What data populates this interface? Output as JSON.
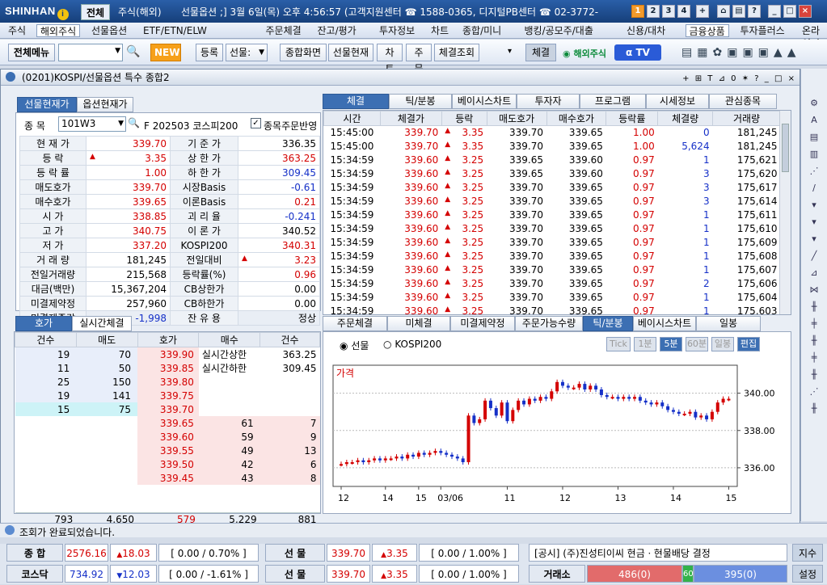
{
  "app": {
    "logo": "SHINHAN",
    "logo_mark": "i",
    "tabs": [
      "전체",
      "주식(해외)"
    ],
    "info": "선물옵션 ;] 3월 6일(목) 오후 4:56:57 (고객지원센터 ☎ 1588-0365, 디지털PB센터 ☎ 02-3772-",
    "win_nums": [
      "1",
      "2",
      "3",
      "4"
    ]
  },
  "menu": [
    "주식",
    "해외주식",
    "선물옵션",
    "ETF/ETN/ELW",
    "주문체결",
    "잔고/평가",
    "투자정보",
    "차트",
    "종합/미니",
    "뱅킹/공모주/대출",
    "신용/대차",
    "금융상품",
    "투자플러스",
    "온라인지점"
  ],
  "toolbar": {
    "all_menu": "전체메뉴",
    "new": "NEW",
    "b1": "등록",
    "sel": "선물:",
    "b2": "종합화면",
    "b3": "선물현재",
    "b4": "차트",
    "b5": "주문",
    "b6": "체결조회",
    "chegyeol": "체결",
    "overseas": "해외주식",
    "tv": "TV"
  },
  "window": {
    "title": "(0201)KOSPI/선물옵션 특수 종합2"
  },
  "left": {
    "tabs": [
      "선물현재가",
      "옵션현재가"
    ],
    "code_label": "종 목",
    "code": "101W3",
    "name": "F 202503 코스피200",
    "check_label": "종목주문반영",
    "rows": [
      {
        "l1": "현 재 가",
        "v1": "339.70",
        "c1": "red",
        "l2": "기 준 가",
        "v2": "336.35",
        "c2": ""
      },
      {
        "l1": "등 락",
        "v1": "3.35",
        "c1": "red",
        "ar": "up",
        "l2": "상 한 가",
        "v2": "363.25",
        "c2": "red"
      },
      {
        "l1": "등 락 률",
        "v1": "1.00",
        "c1": "red",
        "l2": "하 한 가",
        "v2": "309.45",
        "c2": "blue"
      },
      {
        "l1": "매도호가",
        "v1": "339.70",
        "c1": "red",
        "l2": "시장Basis",
        "v2": "-0.61",
        "c2": "blue"
      },
      {
        "l1": "매수호가",
        "v1": "339.65",
        "c1": "red",
        "l2": "이론Basis",
        "v2": "0.21",
        "c2": "red"
      },
      {
        "l1": "시 가",
        "v1": "338.85",
        "c1": "red",
        "l2": "괴 리 율",
        "v2": "-0.241",
        "c2": "blue"
      },
      {
        "l1": "고 가",
        "v1": "340.75",
        "c1": "red",
        "l2": "이 론 가",
        "v2": "340.52",
        "c2": ""
      },
      {
        "l1": "저 가",
        "v1": "337.20",
        "c1": "red",
        "l2": "KOSPI200",
        "v2": "340.31",
        "c2": "red"
      },
      {
        "l1": "거 래 량",
        "v1": "181,245",
        "c1": "",
        "l2": "전일대비",
        "v2": "3.23",
        "c2": "red",
        "ar2": "up"
      },
      {
        "l1": "전일거래량",
        "v1": "215,568",
        "c1": "",
        "l2": "등락률(%)",
        "v2": "0.96",
        "c2": "red"
      },
      {
        "l1": "대금(백만)",
        "v1": "15,367,204",
        "c1": "",
        "l2": "CB상한가",
        "v2": "0.00",
        "c2": ""
      },
      {
        "l1": "미결제약정",
        "v1": "257,960",
        "c1": "",
        "l2": "CB하한가",
        "v2": "0.00",
        "c2": ""
      },
      {
        "l1": "미결제증감",
        "v1": "-1,998",
        "c1": "blue",
        "l2": "잔 유 용",
        "v2": "정상",
        "c2": ""
      }
    ]
  },
  "right": {
    "tabs": [
      "체결",
      "틱/분봉",
      "베이시스차트",
      "투자자",
      "프로그램",
      "시세정보",
      "관심종목"
    ],
    "headers": [
      "시간",
      "체결가",
      "등락",
      "매도호가",
      "매수호가",
      "등락률",
      "체결량",
      "거래량"
    ],
    "rows": [
      [
        "15:45:00",
        "339.70",
        "3.35",
        "339.70",
        "339.65",
        "1.00",
        "0",
        "181,245"
      ],
      [
        "15:45:00",
        "339.70",
        "3.35",
        "339.70",
        "339.65",
        "1.00",
        "5,624",
        "181,245"
      ],
      [
        "15:34:59",
        "339.60",
        "3.25",
        "339.65",
        "339.60",
        "0.97",
        "1",
        "175,621"
      ],
      [
        "15:34:59",
        "339.60",
        "3.25",
        "339.65",
        "339.60",
        "0.97",
        "3",
        "175,620"
      ],
      [
        "15:34:59",
        "339.60",
        "3.25",
        "339.70",
        "339.65",
        "0.97",
        "3",
        "175,617"
      ],
      [
        "15:34:59",
        "339.60",
        "3.25",
        "339.70",
        "339.65",
        "0.97",
        "3",
        "175,614"
      ],
      [
        "15:34:59",
        "339.60",
        "3.25",
        "339.70",
        "339.65",
        "0.97",
        "1",
        "175,611"
      ],
      [
        "15:34:59",
        "339.60",
        "3.25",
        "339.70",
        "339.65",
        "0.97",
        "1",
        "175,610"
      ],
      [
        "15:34:59",
        "339.60",
        "3.25",
        "339.70",
        "339.65",
        "0.97",
        "1",
        "175,609"
      ],
      [
        "15:34:59",
        "339.60",
        "3.25",
        "339.70",
        "339.65",
        "0.97",
        "1",
        "175,608"
      ],
      [
        "15:34:59",
        "339.60",
        "3.25",
        "339.70",
        "339.65",
        "0.97",
        "1",
        "175,607"
      ],
      [
        "15:34:59",
        "339.60",
        "3.25",
        "339.70",
        "339.65",
        "0.97",
        "2",
        "175,606"
      ],
      [
        "15:34:59",
        "339.60",
        "3.25",
        "339.70",
        "339.65",
        "0.97",
        "1",
        "175,604"
      ],
      [
        "15:34:59",
        "339.60",
        "3.25",
        "339.70",
        "339.65",
        "0.97",
        "1",
        "175,603"
      ]
    ]
  },
  "order": {
    "tabs": [
      "호가",
      "실시간체결"
    ],
    "headers": [
      "건수",
      "매도",
      "호가",
      "매수",
      "건수"
    ],
    "asks": [
      [
        "19",
        "70",
        "339.90"
      ],
      [
        "11",
        "50",
        "339.85"
      ],
      [
        "25",
        "150",
        "339.80"
      ],
      [
        "19",
        "141",
        "339.75"
      ],
      [
        "15",
        "75",
        "339.70"
      ]
    ],
    "bids": [
      [
        "339.65",
        "61",
        "7"
      ],
      [
        "339.60",
        "59",
        "9"
      ],
      [
        "339.55",
        "49",
        "13"
      ],
      [
        "339.50",
        "42",
        "6"
      ],
      [
        "339.45",
        "43",
        "8"
      ]
    ],
    "upper_label": "실시간상한",
    "upper_val": "363.25",
    "lower_label": "실시간하한",
    "lower_val": "309.45",
    "totals": [
      "793",
      "4,650",
      "579",
      "5,229",
      "881"
    ]
  },
  "chartpanel": {
    "tabs": [
      "주문체결",
      "미체결",
      "미결제약정",
      "주문가능수량",
      "틱/분봉",
      "베이시스차트",
      "일봉"
    ],
    "radio1": "선물",
    "radio2": "KOSPI200",
    "periods": [
      "Tick",
      "1분",
      "5분",
      "60분",
      "일봉",
      "편집"
    ],
    "label": "가격"
  },
  "chart_data": {
    "type": "candlestick",
    "title": "가격",
    "x_ticks": [
      "12",
      "14",
      "15",
      "03/06",
      "11",
      "12",
      "13",
      "14",
      "15"
    ],
    "y_ticks": [
      "340.00",
      "338.00",
      "336.00"
    ],
    "ylim": [
      335.0,
      341.5
    ],
    "series": [
      {
        "name": "",
        "values": [
          336.2,
          336.3,
          336.3,
          336.4,
          336.3,
          336.4,
          336.5,
          336.4,
          336.5,
          336.5,
          336.6,
          336.5,
          336.7,
          336.6,
          336.8,
          336.7,
          336.8,
          336.9,
          336.8,
          336.7,
          336.6,
          336.5,
          336.3,
          338.8,
          338.4,
          338.6,
          339.6,
          339.2,
          338.8,
          339.5,
          338.5,
          339.1,
          339.6,
          339.4,
          339.7,
          339.6,
          339.8,
          339.7,
          340.1,
          340.6,
          340.4,
          340.3,
          340.3,
          340.5,
          340.2,
          340.4,
          340.2,
          339.9,
          339.8,
          339.8,
          339.7,
          339.8,
          339.7,
          339.8,
          339.6,
          339.5,
          339.4,
          339.5,
          339.3,
          339.1,
          339.0,
          338.9,
          338.9,
          339.0,
          338.7,
          338.8,
          338.6,
          339.0,
          339.5,
          339.7,
          339.7
        ]
      }
    ]
  },
  "status": {
    "text": "조회가 완료되었습니다."
  },
  "bottom": {
    "r1": {
      "l": "종 합",
      "v": "2576.16",
      "d": "18.03",
      "p": "[ 0.00 / 0.70% ]",
      "f": "선 물",
      "fv": "339.70",
      "fd": "3.35",
      "fp": "[ 0.00 / 1.00% ]",
      "news": "[공시] (주)진성티이씨 현금ㆍ현물배당 결정",
      "btn": "지수"
    },
    "r2": {
      "l": "코스닥",
      "v": "734.92",
      "d": "12.03",
      "p": "[ 0.00 / -1.61% ]",
      "f": "선 물",
      "fv": "339.70",
      "fd": "3.35",
      "fp": "[ 0.00 / 1.00% ]",
      "ex": "거래소",
      "red": "486(0)",
      "green": "60",
      "blue": "395(0)",
      "btn": "설정"
    }
  },
  "colors": {
    "up": "#d40000",
    "down": "#1530c8",
    "accent": "#3c6fb3"
  }
}
